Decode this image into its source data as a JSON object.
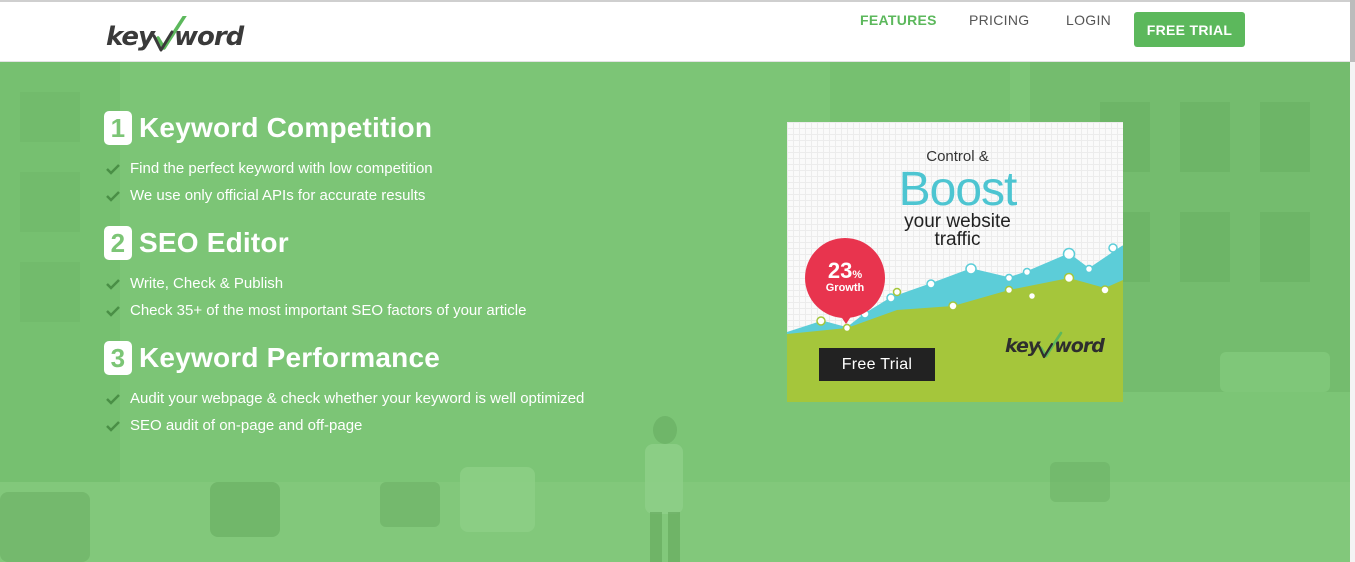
{
  "header": {
    "logo_text": "key word",
    "nav": [
      {
        "label": "FEATURES",
        "active": true
      },
      {
        "label": "PRICING",
        "active": false
      },
      {
        "label": "LOGIN",
        "active": false
      }
    ],
    "cta_label": "FREE TRIAL"
  },
  "features": [
    {
      "number": "1",
      "title": "Keyword Competition",
      "bullets": [
        "Find the perfect keyword with low competition",
        "We use only official APIs for accurate results"
      ]
    },
    {
      "number": "2",
      "title": "SEO Editor",
      "bullets": [
        "Write, Check & Publish",
        "Check 35+ of the most important SEO factors of your article"
      ]
    },
    {
      "number": "3",
      "title": "Keyword Performance",
      "bullets": [
        "Audit your webpage & check whether your keyword is well optimized",
        "SEO audit of on-page and off-page"
      ]
    }
  ],
  "ad": {
    "control": "Control &",
    "boost": "Boost",
    "line1": "your website",
    "line2": "traffic",
    "growth_value": "23",
    "growth_unit": "%",
    "growth_label": "Growth",
    "button_label": "Free Trial",
    "logo_text": "key word"
  },
  "colors": {
    "brand_green": "#5cb85c",
    "hero_green": "#7cc576",
    "boost_cyan": "#4dc5d1",
    "growth_red": "#e8344e",
    "chart_lime": "#a5c63b"
  },
  "icons": {
    "bullet": "check-icon",
    "logo": "checkmark-logo-icon"
  }
}
